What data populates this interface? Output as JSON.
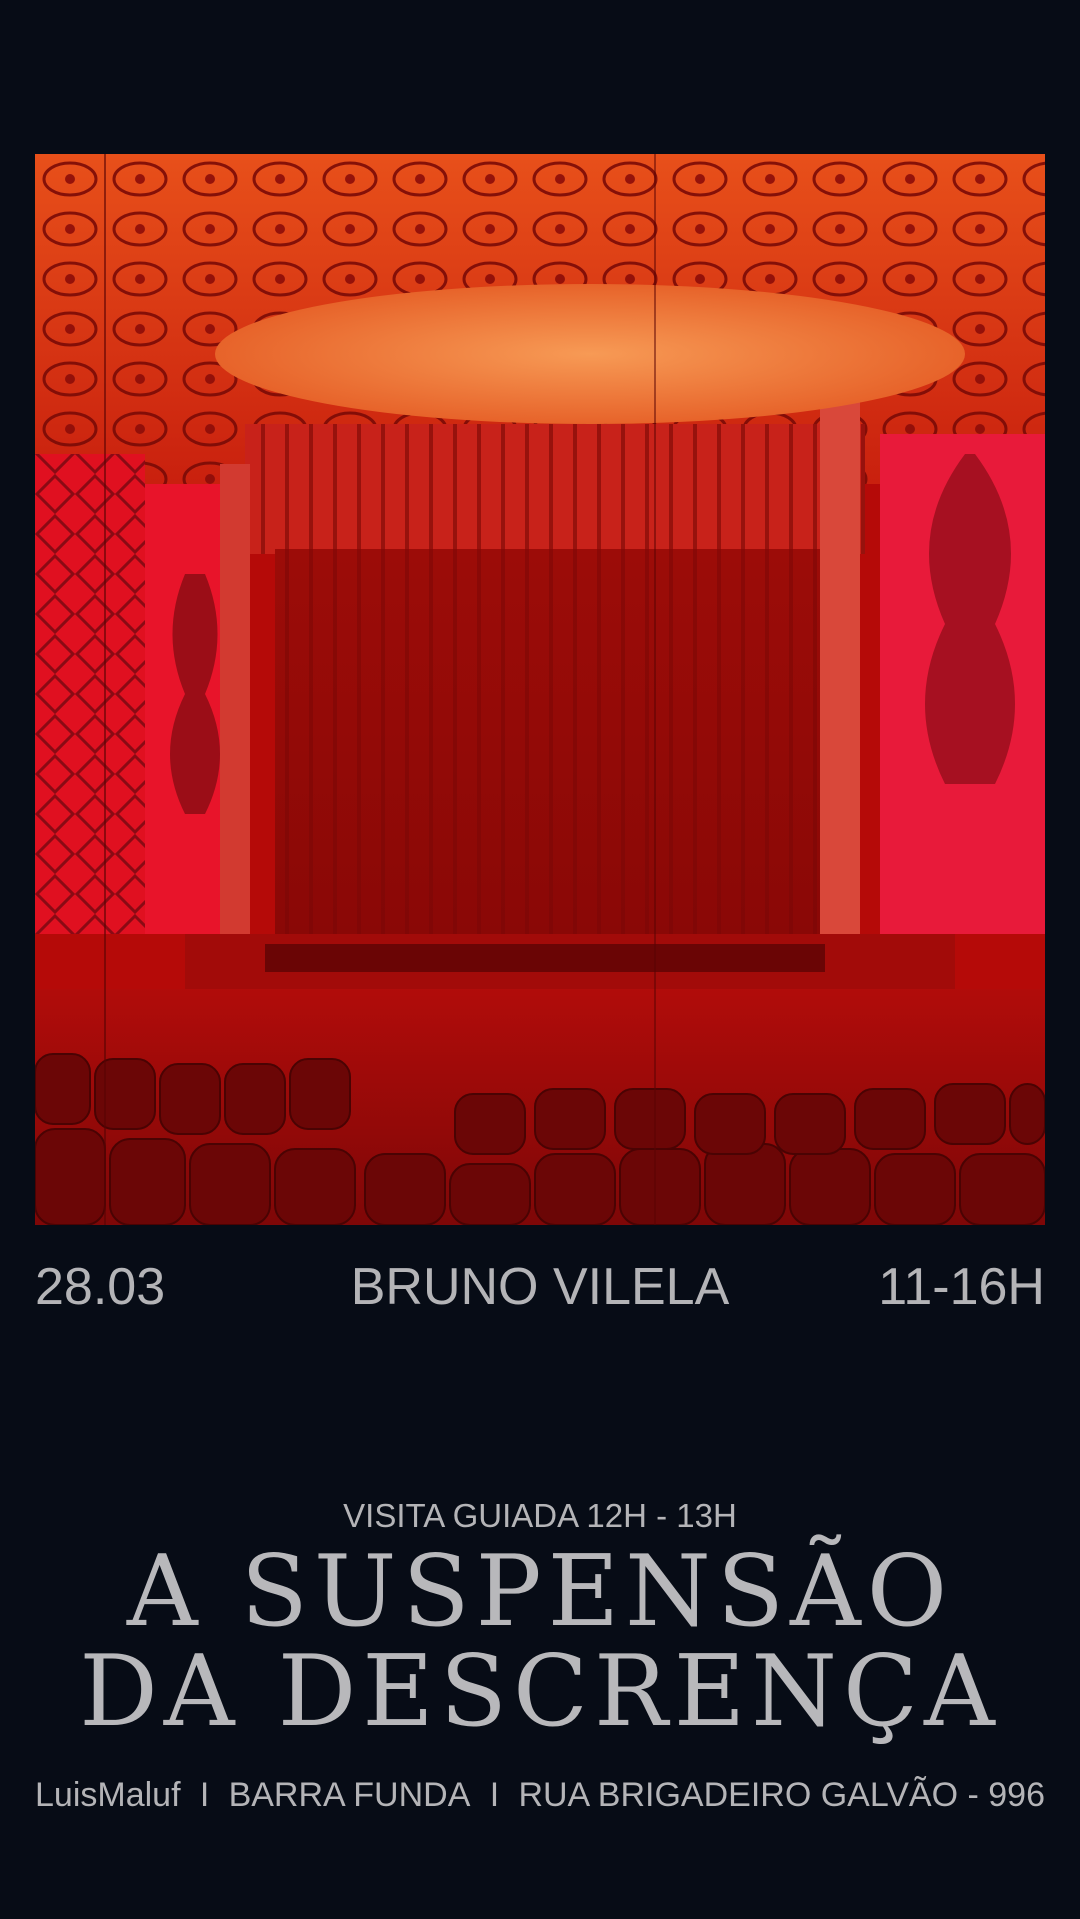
{
  "poster": {
    "date": "28.03",
    "artist": "BRUNO VILELA",
    "hours": "11-16H",
    "guided_visit": "VISITA GUIADA 12H - 13H",
    "title_line_1": "A SUSPENSÃO",
    "title_line_2": "DA DESCRENÇA",
    "venue": "LuisMaluf",
    "separator": "I",
    "neighborhood": "BARRA FUNDA",
    "address": "RUA BRIGADEIRO GALVÃO - 996"
  },
  "colors": {
    "background": "#070c16",
    "text": "#b4b4b7",
    "photo_red": "#c8140c"
  }
}
